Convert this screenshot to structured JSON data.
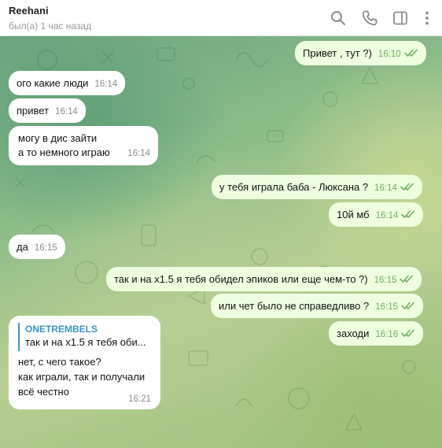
{
  "header": {
    "name": "Reehani",
    "status": "был(а) 1 час назад",
    "icons": [
      "search-icon",
      "phone-icon",
      "sidebar-toggle-icon",
      "more-vert-icon"
    ]
  },
  "colors": {
    "outgoing_bubble": "#eefedf",
    "incoming_bubble": "#ffffff",
    "check_marks": "#6fae60",
    "reply_accent": "#3a95c9"
  },
  "messages": [
    {
      "dir": "out",
      "text": "Привет , тут ?)",
      "time": "16:10",
      "read": true
    },
    {
      "dir": "in",
      "text": "ого какие люди",
      "time": "16:14"
    },
    {
      "dir": "in",
      "text": "привет",
      "time": "16:14"
    },
    {
      "dir": "in",
      "lines": [
        "могу в дис зайти",
        "а то немного играю"
      ],
      "time": "16:14"
    },
    {
      "dir": "out",
      "text": "у тебя играла баба - Люксана ?",
      "time": "16:14",
      "read": true
    },
    {
      "dir": "out",
      "text": "10й мб",
      "time": "16:14",
      "read": true
    },
    {
      "dir": "in",
      "text": "да",
      "time": "16:15"
    },
    {
      "dir": "out",
      "text": "так и на х1.5 я тебя обидел эпиков или еще чем-то ?)",
      "time": "16:15",
      "read": true
    },
    {
      "dir": "out",
      "text": "или чет было не справедливо ?",
      "time": "16:15",
      "read": true
    },
    {
      "dir": "out",
      "text": "заходи",
      "time": "16:16",
      "read": true
    },
    {
      "dir": "in",
      "reply": {
        "author": "ONETREMBELS",
        "text": "так и на х1.5 я тебя оби..."
      },
      "lines": [
        "нет, с чего такое?",
        "как играли, так и получали",
        "всё честно"
      ],
      "time": "16:21"
    }
  ]
}
